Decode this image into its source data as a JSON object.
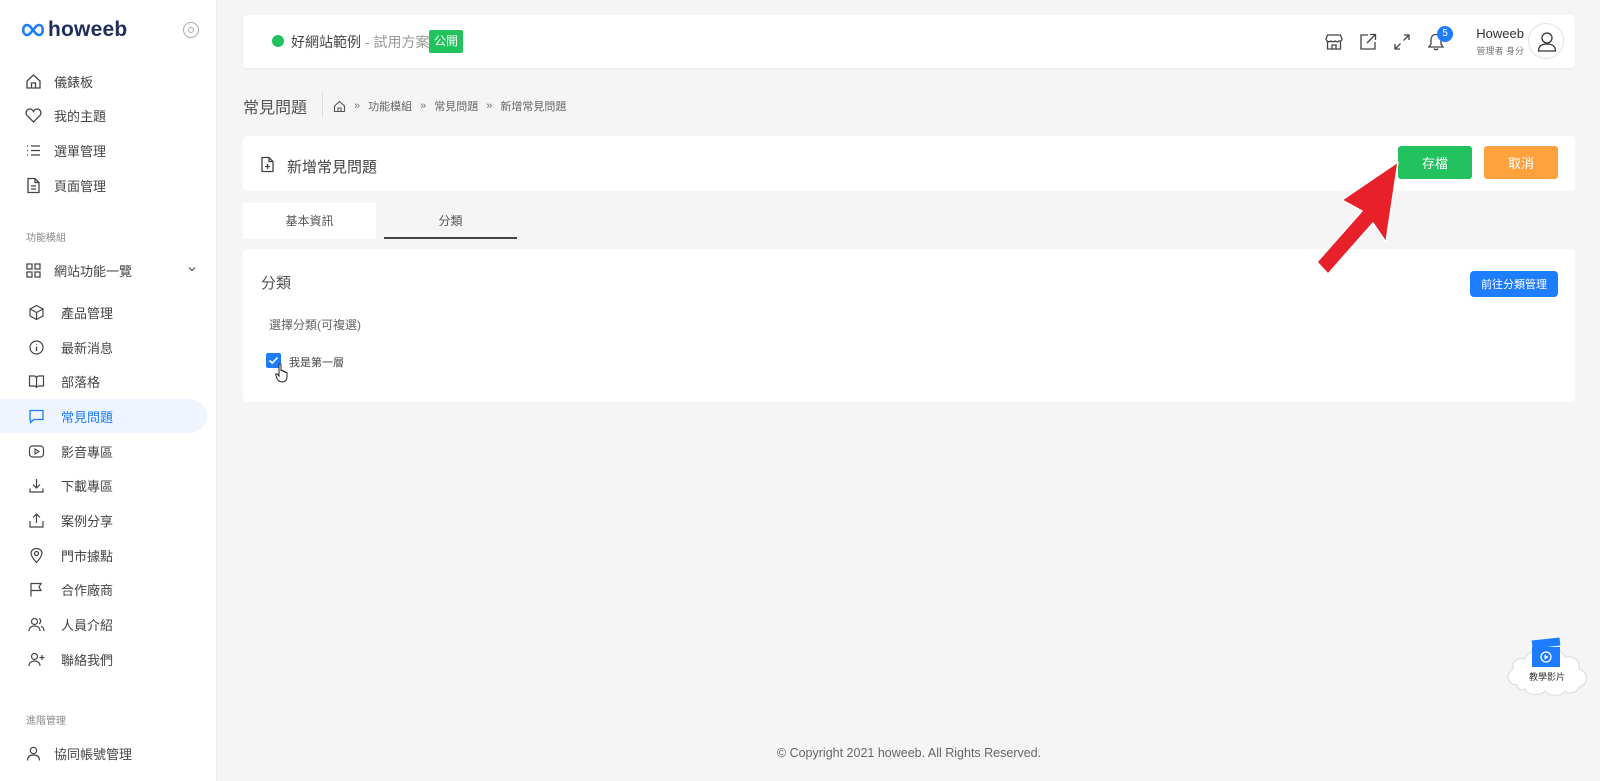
{
  "brand": {
    "name": "howeeb"
  },
  "sidebar": {
    "items": [
      {
        "label": "儀錶板",
        "icon": "home-icon"
      },
      {
        "label": "我的主題",
        "icon": "heart-icon"
      },
      {
        "label": "選單管理",
        "icon": "list-icon"
      },
      {
        "label": "頁面管理",
        "icon": "file-icon"
      }
    ],
    "section_modules": "功能模組",
    "group": {
      "label": "網站功能一覽",
      "icon": "grid-icon"
    },
    "sub_items": [
      {
        "label": "產品管理",
        "icon": "box-icon"
      },
      {
        "label": "最新消息",
        "icon": "info-icon"
      },
      {
        "label": "部落格",
        "icon": "book-icon"
      },
      {
        "label": "常見問題",
        "icon": "chat-icon"
      },
      {
        "label": "影音專區",
        "icon": "video-icon"
      },
      {
        "label": "下載專區",
        "icon": "download-icon"
      },
      {
        "label": "案例分享",
        "icon": "share-icon"
      },
      {
        "label": "門市據點",
        "icon": "map-pin-icon"
      },
      {
        "label": "合作廠商",
        "icon": "flag-icon"
      },
      {
        "label": "人員介紹",
        "icon": "users-icon"
      },
      {
        "label": "聯絡我們",
        "icon": "user-plus-icon"
      }
    ],
    "active_sub_index": 3,
    "section_advanced": "進階管理",
    "bottom_item": {
      "label": "協同帳號管理",
      "icon": "user-icon"
    }
  },
  "topbar": {
    "site_name": "好網站範例",
    "plan": " - 試用方案",
    "badge": "公開",
    "icons": [
      "store-icon",
      "external-link-icon",
      "fullscreen-icon",
      "bell-icon"
    ],
    "notification_count": "5",
    "user_name": "Howeeb",
    "user_role": "管理者 身分"
  },
  "breadcrumb": {
    "title": "常見問題",
    "items": [
      "功能模組",
      "常見問題",
      "新增常見問題"
    ],
    "separator": "»"
  },
  "form": {
    "title": "新增常見問題",
    "save_label": "存檔",
    "cancel_label": "取消"
  },
  "tabs": [
    {
      "label": "基本資訊",
      "active": false
    },
    {
      "label": "分類",
      "active": true
    }
  ],
  "category": {
    "title": "分類",
    "goto_label": "前往分類管理",
    "select_label": "選擇分類(可複選)",
    "options": [
      {
        "label": "我是第一層",
        "checked": true
      }
    ]
  },
  "footer": {
    "text": "© Copyright 2021 howeeb. All Rights Reserved."
  },
  "tutorial": {
    "label": "教學影片"
  },
  "colors": {
    "primary": "#1e7cff",
    "success": "#22c35e",
    "warning": "#ffa23e",
    "annotation": "#e8202a"
  }
}
